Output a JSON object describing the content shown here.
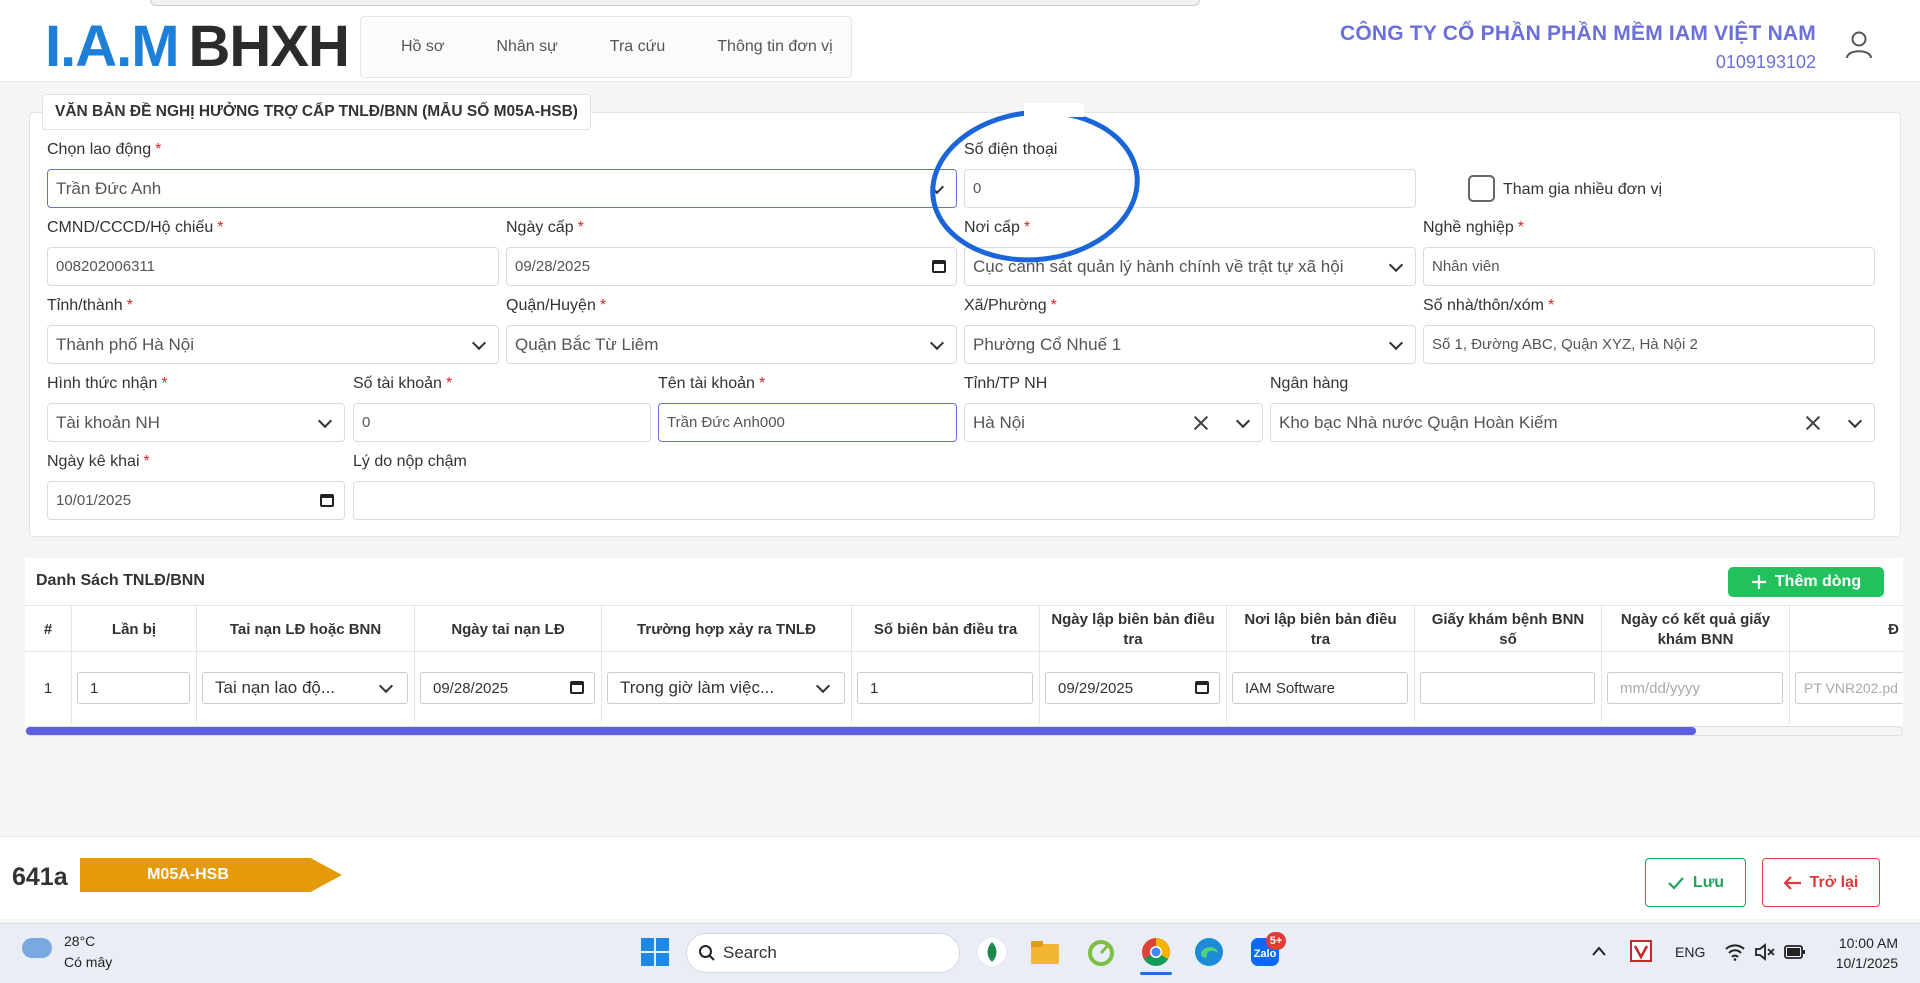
{
  "header": {
    "logo_iam": "I.A.M",
    "logo_bhxh": "BHXH",
    "nav": [
      "Hồ sơ",
      "Nhân sự",
      "Tra cứu",
      "Thông tin đơn vị"
    ],
    "company_name": "CÔNG TY CỔ PHẦN PHẦN MỀM IAM VIỆT NAM",
    "tax_code": "0109193102"
  },
  "form": {
    "title": "VĂN BẢN ĐỀ NGHỊ HƯỞNG TRỢ CẤP TNLĐ/BNN (MẪU SỐ M05A-HSB)",
    "employee": {
      "label": "Chọn lao động",
      "value": "Trần Đức Anh"
    },
    "phone": {
      "label": "Số điện thoại",
      "value": "0"
    },
    "multi_unit": {
      "label": "Tham gia nhiều đơn vị",
      "checked": false
    },
    "id_number": {
      "label": "CMND/CCCD/Hộ chiếu",
      "value": "008202006311"
    },
    "issue_date": {
      "label": "Ngày cấp",
      "value": "09/28/2025"
    },
    "issue_place": {
      "label": "Nơi cấp",
      "value": "Cục cảnh sát quản lý hành chính về trật tự xã hội"
    },
    "occupation": {
      "label": "Nghề nghiệp",
      "value": "Nhân viên"
    },
    "province": {
      "label": "Tỉnh/thành",
      "value": "Thành phố Hà Nội"
    },
    "district": {
      "label": "Quận/Huyện",
      "value": "Quận Bắc Từ Liêm"
    },
    "ward": {
      "label": "Xã/Phường",
      "value": "Phường Cổ Nhuế 1"
    },
    "address": {
      "label": "Số nhà/thôn/xóm",
      "value": "Số 1, Đường ABC, Quận XYZ, Hà Nội 2"
    },
    "receive_method": {
      "label": "Hình thức nhận",
      "value": "Tài khoản NH"
    },
    "account_no": {
      "label": "Số tài khoản",
      "value": "0"
    },
    "account_name": {
      "label": "Tên tài khoản",
      "value": "Trần Đức Anh000"
    },
    "bank_province": {
      "label": "Tỉnh/TP NH",
      "value": "Hà Nội"
    },
    "bank": {
      "label": "Ngân hàng",
      "value": "Kho bạc Nhà nước Quận Hoàn Kiếm"
    },
    "declare_date": {
      "label": "Ngày kê khai",
      "value": "10/01/2025"
    },
    "late_reason": {
      "label": "Lý do nộp chậm",
      "value": ""
    }
  },
  "table": {
    "title": "Danh Sách TNLĐ/BNN",
    "add_label": "Thêm dòng",
    "headers": [
      "#",
      "Lần bị",
      "Tai nạn LĐ hoặc BNN",
      "Ngày tai nạn LĐ",
      "Trường hợp xảy ra TNLĐ",
      "Số biên bản điều tra",
      "Ngày lập biên bản điều tra",
      "Nơi lập biên bản điều tra",
      "Giấy khám bệnh BNN số",
      "Ngày có kết quả giấy khám BNN",
      "Đ"
    ],
    "row": {
      "index": "1",
      "times": "1",
      "type": "Tai nạn lao độ...",
      "accident_date": "09/28/2025",
      "case": "Trong giờ làm việc...",
      "report_no": "1",
      "report_date": "09/29/2025",
      "report_place": "IAM Software",
      "bnn_no": "",
      "bnn_date_placeholder": "mm/dd/yyyy",
      "next": "PT VNR202.pd"
    },
    "scroll_fraction": 0.89
  },
  "footer": {
    "code": "641a",
    "form_tag": "M05A-HSB",
    "save_label": "Lưu",
    "back_label": "Trở lại"
  },
  "taskbar": {
    "temp": "28°C",
    "weather": "Có mây",
    "search": "Search",
    "notif_badge": "5+",
    "lang": "ENG",
    "time": "10:00 AM",
    "date": "10/1/2025"
  }
}
